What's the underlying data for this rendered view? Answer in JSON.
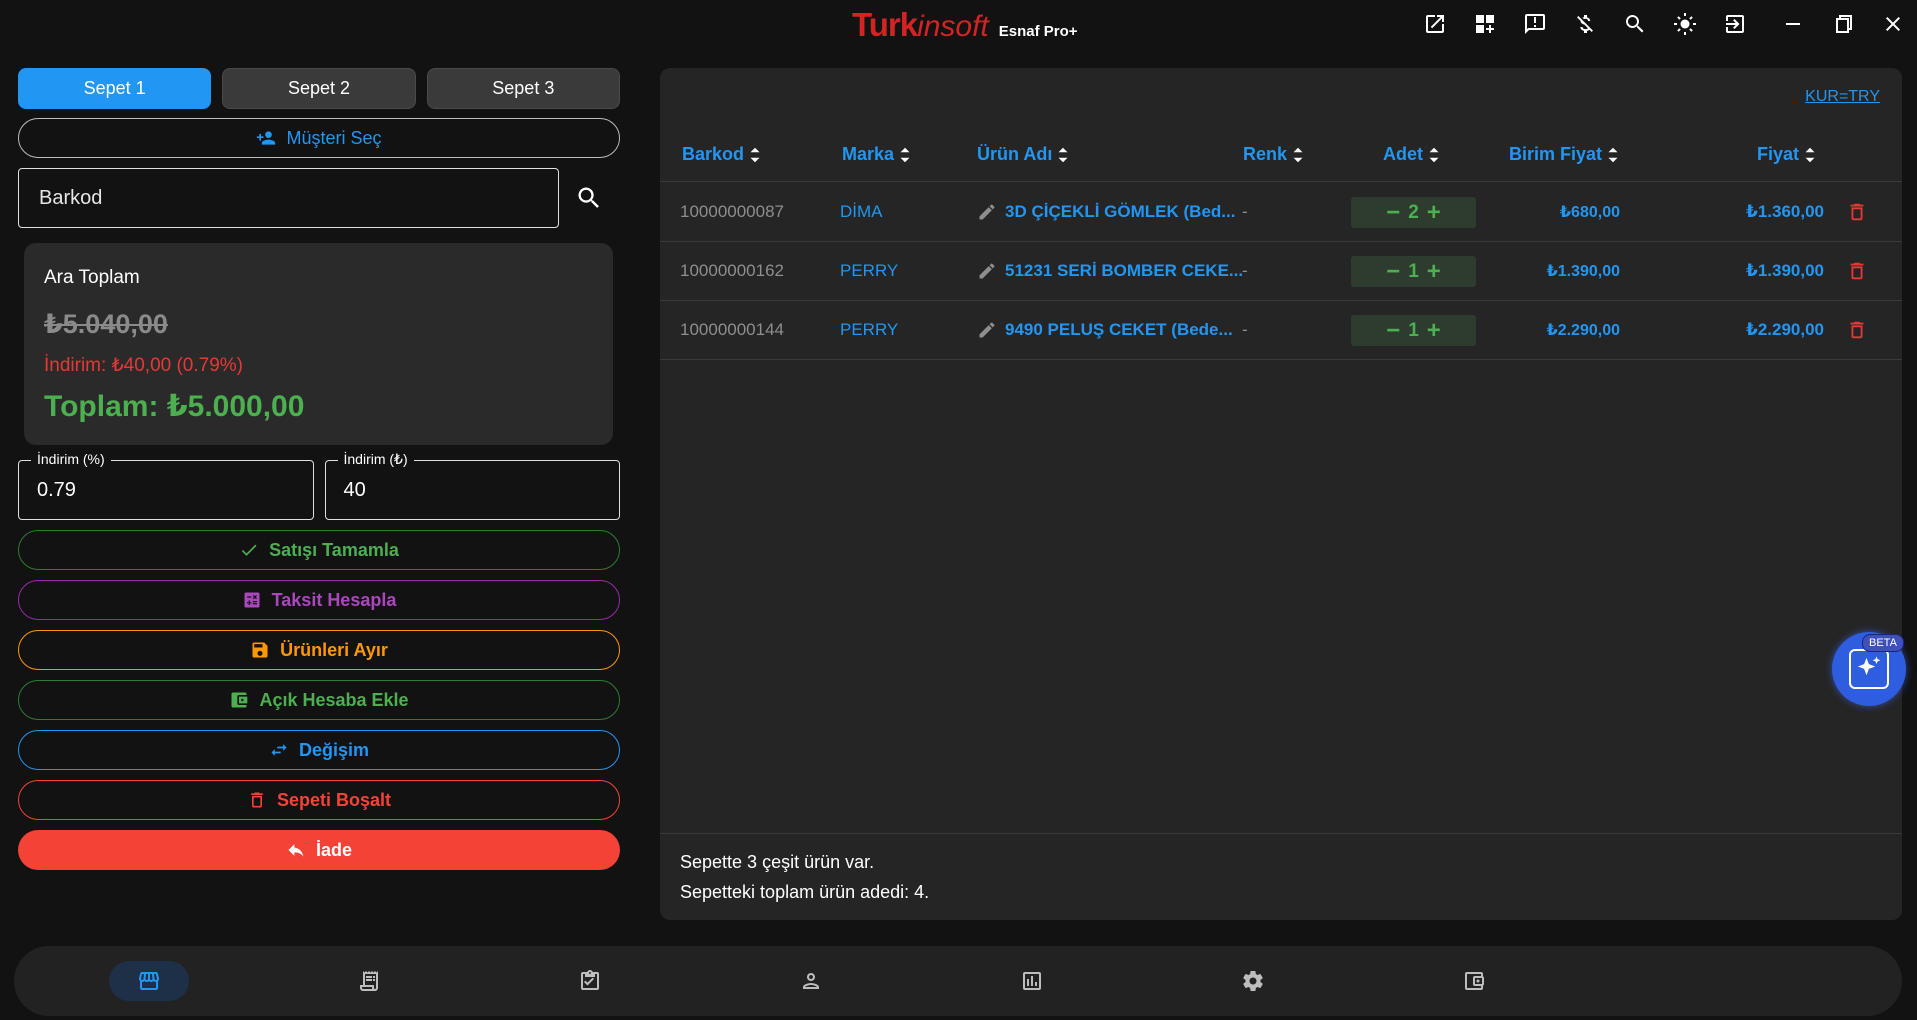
{
  "app": {
    "brand_turk": "Turk",
    "brand_insoft": "insoft",
    "brand_tag": "Esnaf Pro+"
  },
  "titlebar_icons": [
    "open-external-icon",
    "dashboard-add-icon",
    "feedback-icon",
    "money-off-icon",
    "search-person-icon",
    "brightness-icon",
    "logout-icon"
  ],
  "window_controls": [
    "minimize-icon",
    "restore-icon",
    "close-icon"
  ],
  "baskets": {
    "tabs": [
      "Sepet 1",
      "Sepet 2",
      "Sepet 3"
    ],
    "active_tab": 0
  },
  "customer": {
    "select_label": "Müşteri Seç"
  },
  "search": {
    "placeholder": "Barkod"
  },
  "summary": {
    "subtotal_label": "Ara Toplam",
    "subtotal_old": "₺5.040,00",
    "discount_text": "İndirim: ₺40,00 (0.79%)",
    "total_text": "Toplam: ₺5.000,00"
  },
  "discount_fields": {
    "percent_label": "İndirim (%)",
    "percent_value": "0.79",
    "amount_label": "İndirim (₺)",
    "amount_value": "40"
  },
  "actions": {
    "complete": "Satışı Tamamla",
    "installment": "Taksit Hesapla",
    "reserve": "Ürünleri Ayır",
    "open_account": "Açık Hesaba Ekle",
    "exchange": "Değişim",
    "clear": "Sepeti Boşalt",
    "return": "İade"
  },
  "table": {
    "currency_link": "KUR=TRY",
    "headers": {
      "barkod": "Barkod",
      "marka": "Marka",
      "urun": "Ürün Adı",
      "renk": "Renk",
      "adet": "Adet",
      "birim": "Birim Fiyat",
      "fiyat": "Fiyat"
    },
    "rows": [
      {
        "barkod": "10000000087",
        "marka": "DİMA",
        "urun": "3D ÇİÇEKLİ GÖMLEK (Bed...",
        "renk": "-",
        "adet": "2",
        "birim": "₺680,00",
        "fiyat": "₺1.360,00"
      },
      {
        "barkod": "10000000162",
        "marka": "PERRY",
        "urun": "51231 SERİ BOMBER CEKE...",
        "renk": "-",
        "adet": "1",
        "birim": "₺1.390,00",
        "fiyat": "₺1.390,00"
      },
      {
        "barkod": "10000000144",
        "marka": "PERRY",
        "urun": "9490 PELUŞ CEKET (Bede...",
        "renk": "-",
        "adet": "1",
        "birim": "₺2.290,00",
        "fiyat": "₺2.290,00"
      }
    ],
    "footer_line1": "Sepette 3 çeşit ürün var.",
    "footer_line2": "Sepetteki toplam ürün adedi: 4."
  },
  "ai_assistant": {
    "badge": "BETA"
  },
  "bottom_nav": {
    "items": [
      "store-icon",
      "receipt-icon",
      "clipboard-check-icon",
      "person-icon",
      "chart-icon",
      "settings-icon",
      "wallet-icon"
    ],
    "active": 0
  },
  "colors": {
    "accent": "#2196f3",
    "success": "#4caf50",
    "danger": "#f44336",
    "warning": "#ff9800",
    "purple": "#ab47bc",
    "brand": "#d32323"
  }
}
